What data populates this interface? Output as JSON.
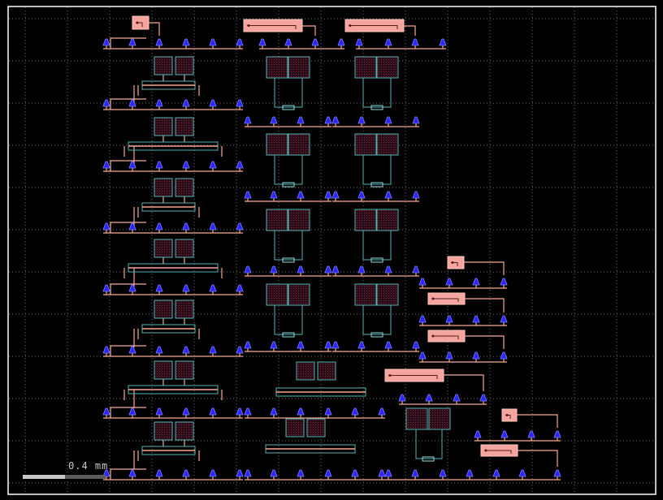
{
  "scale_bar": {
    "label": "0.4 mm"
  },
  "colors": {
    "background": "#000000",
    "frame": "#ffffff",
    "grid": "#6e6e6e",
    "wire": "#f5a993",
    "heater_fill": "#f5a5a0",
    "heater_stroke": "#ffc5b8",
    "pad_fill": "#2b25ff",
    "pad_stroke": "#8080ff",
    "device_stroke": "#4fb3b3",
    "device_fill": "#3a0f1d",
    "scale_bar": "#c8c8c8"
  }
}
